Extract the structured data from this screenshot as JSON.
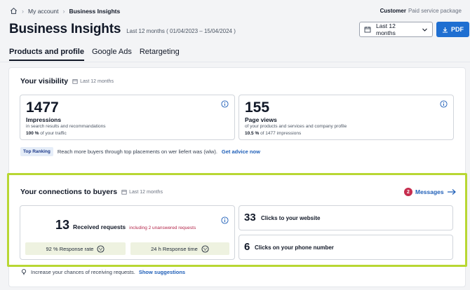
{
  "breadcrumb": {
    "items": [
      "My account",
      "Business Insights"
    ]
  },
  "customer": {
    "label": "Customer",
    "package": "Paid service package"
  },
  "header": {
    "title": "Business Insights",
    "period": "Last 12 months ( 01/04/2023 – 15/04/2024 )",
    "date_select_value": "Last 12 months",
    "pdf_label": "PDF"
  },
  "tabs": [
    {
      "label": "Products and profile",
      "active": true
    },
    {
      "label": "Google Ads",
      "active": false
    },
    {
      "label": "Retargeting",
      "active": false
    }
  ],
  "visibility": {
    "title": "Your visibility",
    "period": "Last 12 months",
    "impressions": {
      "value": "1477",
      "label": "Impressions",
      "desc": "in search results and recommandations",
      "share_value": "100 %",
      "share_text": "of your traffic"
    },
    "pageviews": {
      "value": "155",
      "label": "Page views",
      "desc": "of your products and services and company profile",
      "share_value": "10.5 %",
      "share_text": "of 1477 impressions"
    },
    "ranking": {
      "badge": "Top Ranking",
      "text": "Reach more buyers through top placements on  wer liefert was (wlw).",
      "link": "Get advice now"
    }
  },
  "connections": {
    "title": "Your connections to buyers",
    "period": "Last 12 months",
    "messages_count": "2",
    "messages_label": "Messages",
    "requests": {
      "value": "13",
      "label": "Received requests",
      "note": "including 2 unanswered requests"
    },
    "response_rate": "92 % Response rate",
    "response_time": "24 h Response time",
    "website_clicks": {
      "value": "33",
      "label": "Clicks to your website"
    },
    "phone_clicks": {
      "value": "6",
      "label": "Clicks on your phone number"
    }
  },
  "tip": {
    "text": "Increase your chances of receiving requests.",
    "link": "Show suggestions"
  },
  "colors": {
    "accent": "#1f6fd1",
    "highlight": "#b8d733",
    "badge_red": "#c62d4e",
    "note_red": "#b3264a"
  }
}
